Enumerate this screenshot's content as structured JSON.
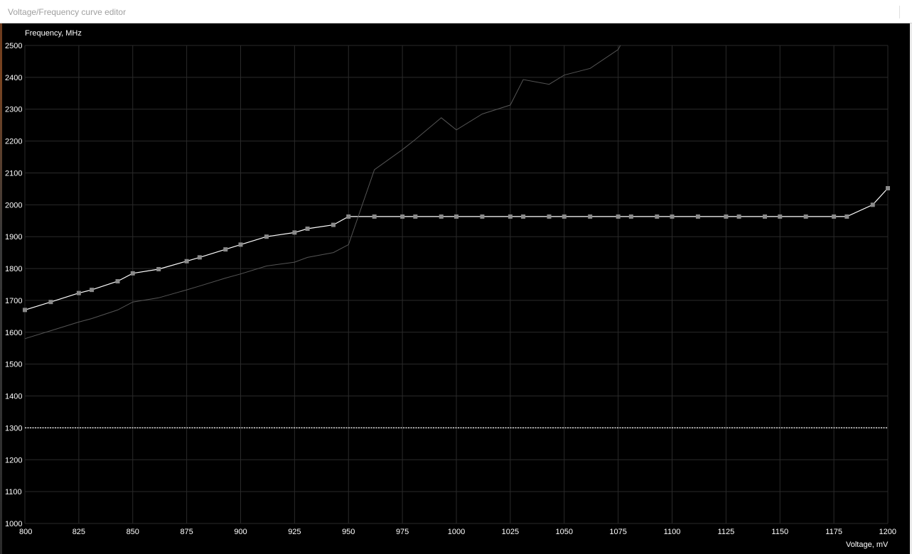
{
  "window": {
    "title": "Voltage/Frequency curve editor",
    "background": "#000000"
  },
  "chart_data": {
    "type": "line",
    "xlabel": "Voltage, mV",
    "ylabel": "Frequency, MHz",
    "xlim": [
      800,
      1200
    ],
    "ylim": [
      1000,
      2500
    ],
    "grid": true,
    "x_ticks": [
      800,
      825,
      850,
      875,
      900,
      925,
      950,
      975,
      1000,
      1025,
      1050,
      1075,
      1100,
      1125,
      1150,
      1175,
      1200
    ],
    "y_ticks": [
      1000,
      1100,
      1200,
      1300,
      1400,
      1500,
      1600,
      1700,
      1800,
      1900,
      2000,
      2100,
      2200,
      2300,
      2400,
      2500
    ],
    "series": [
      {
        "role": "vf-curve",
        "color": "#ffffff",
        "marker": "square",
        "x": [
          800,
          812,
          825,
          831,
          843,
          850,
          862,
          875,
          881,
          893,
          900,
          912,
          925,
          931,
          943,
          950,
          962,
          975,
          981,
          993,
          1000,
          1012,
          1025,
          1031,
          1043,
          1050,
          1062,
          1075,
          1081,
          1093,
          1100,
          1112,
          1125,
          1131,
          1143,
          1150,
          1162,
          1175,
          1181,
          1193,
          1200
        ],
        "y": [
          1670,
          1695,
          1723,
          1733,
          1760,
          1785,
          1798,
          1823,
          1835,
          1860,
          1875,
          1900,
          1913,
          1925,
          1937,
          1963,
          1963,
          1963,
          1963,
          1963,
          1963,
          1963,
          1963,
          1963,
          1963,
          1963,
          1963,
          1963,
          1963,
          1963,
          1963,
          1963,
          1963,
          1963,
          1963,
          1963,
          1963,
          1963,
          1963,
          2000,
          2052
        ]
      },
      {
        "role": "default-curve",
        "color": "#555555",
        "marker": "none",
        "x": [
          800,
          812,
          825,
          831,
          843,
          850,
          862,
          875,
          881,
          893,
          900,
          912,
          925,
          931,
          943,
          950,
          962,
          975,
          981,
          993,
          1000,
          1012,
          1025,
          1031,
          1043,
          1050,
          1062,
          1075,
          1076
        ],
        "y": [
          1580,
          1605,
          1632,
          1643,
          1670,
          1695,
          1708,
          1733,
          1745,
          1770,
          1783,
          1808,
          1820,
          1835,
          1850,
          1875,
          2110,
          2173,
          2205,
          2273,
          2235,
          2285,
          2313,
          2393,
          2378,
          2407,
          2428,
          2487,
          2500
        ]
      }
    ],
    "reference_lines": [
      {
        "axis": "y",
        "value": 1300,
        "style": "dotted",
        "color": "#ffffff"
      }
    ]
  }
}
